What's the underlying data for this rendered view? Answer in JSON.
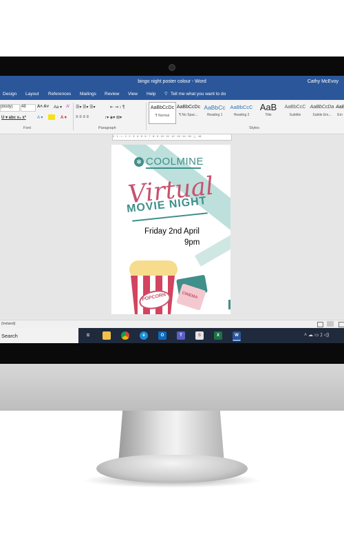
{
  "window": {
    "title": "bingo night poster colour  -  Word",
    "user": "Cathy McEvoy"
  },
  "menu": {
    "tabs": [
      "Design",
      "Layout",
      "References",
      "Mailings",
      "Review",
      "View",
      "Help"
    ],
    "tell_me": "Tell me what you want to do"
  },
  "ribbon": {
    "font_name": "(Body)",
    "font_size": "48",
    "font_group_label": "Font",
    "paragraph_group_label": "Paragraph",
    "styles_group_label": "Styles",
    "styles": [
      {
        "sample": "AaBbCcDc",
        "label": "¶ Normal"
      },
      {
        "sample": "AaBbCcDc",
        "label": "¶ No Spac..."
      },
      {
        "sample": "AaBbCc",
        "label": "Heading 1"
      },
      {
        "sample": "AaBbCcC",
        "label": "Heading 2"
      },
      {
        "sample": "AaB",
        "label": "Title"
      },
      {
        "sample": "AaBbCcC",
        "label": "Subtitle"
      },
      {
        "sample": "AaBbCcDa",
        "label": "Subtle Em..."
      },
      {
        "sample": "AaBi",
        "label": "Em"
      }
    ]
  },
  "ruler": "2 · 1 · ⌂ · 1 · 2 · 3 · 4 · 5 · 6 · 7 · 8 · 9 · 10 · 11 · 12 · 13 · 14 · 15 · △ · 18",
  "poster": {
    "brand": "COOLMINE",
    "headline_1": "Virtual",
    "headline_2": "MOVIE NIGHT",
    "date": "Friday 2nd April",
    "time": "9pm",
    "popcorn_label": "POPCORN",
    "ticket_label": "CINEMA",
    "colors": {
      "teal": "#3f8f8a",
      "pink": "#c9516e",
      "film": "#bde0dc"
    }
  },
  "status": {
    "language": "(Ireland)"
  },
  "taskbar": {
    "search": "Search",
    "apps": [
      "task-view",
      "file-explorer",
      "chrome",
      "edge",
      "outlook",
      "teams",
      "slack-like",
      "excel",
      "word"
    ]
  }
}
